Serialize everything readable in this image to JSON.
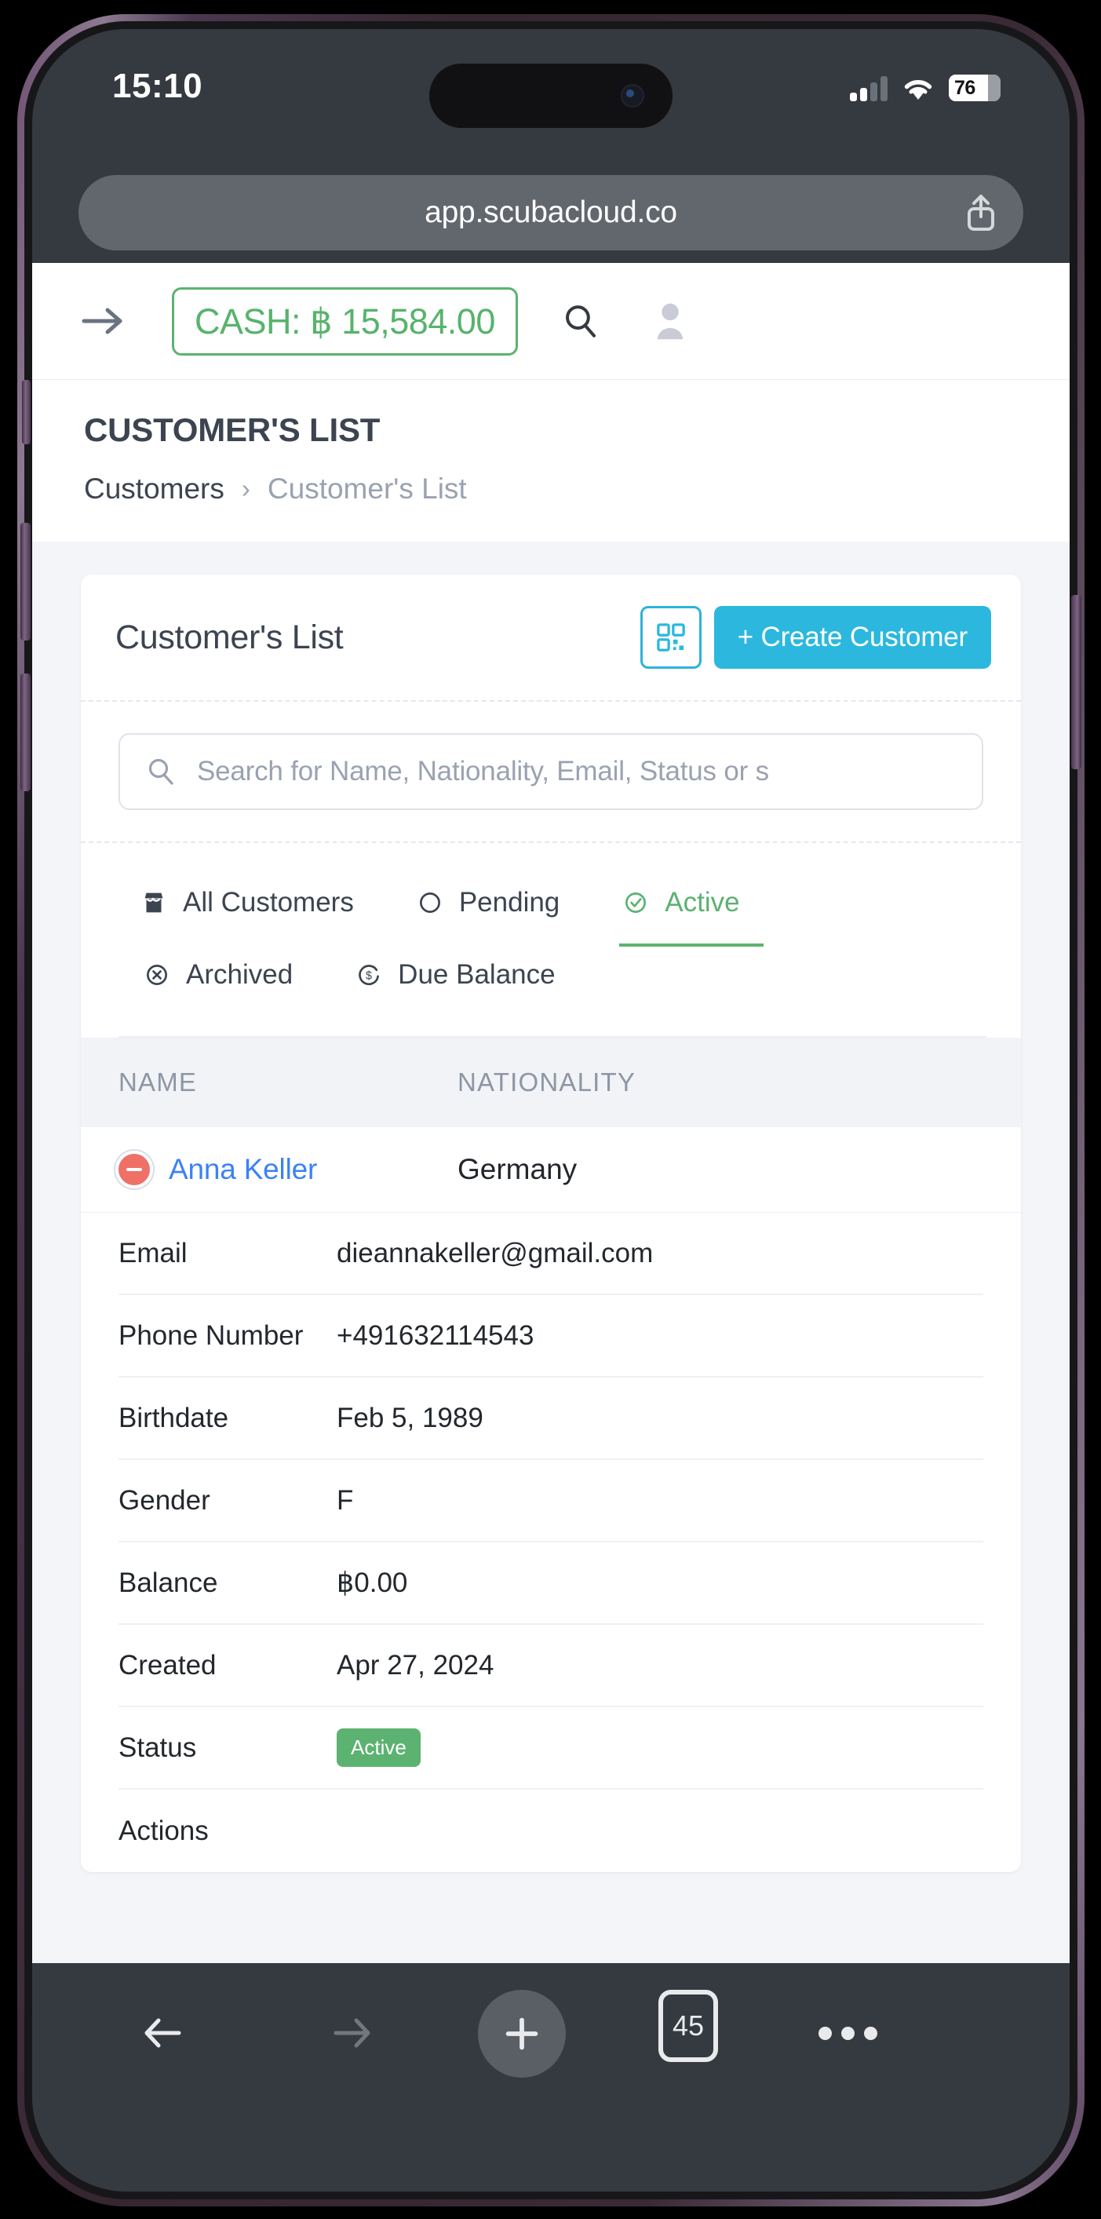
{
  "status_bar": {
    "time": "15:10",
    "battery_level": "76",
    "signal_icon": "cellular-signal-icon",
    "wifi_icon": "wifi-icon",
    "battery_icon": "battery-icon"
  },
  "browser": {
    "url": "app.scubacloud.co",
    "share_icon": "share-icon",
    "bottom": {
      "back_icon": "arrow-left-icon",
      "forward_icon": "arrow-right-icon",
      "new_tab_icon": "plus-icon",
      "tab_count": "45",
      "more_icon": "ellipsis-icon"
    }
  },
  "app_header": {
    "menu_icon": "arrow-right-icon",
    "cash_label": "CASH: ฿ 15,584.00",
    "search_icon": "search-icon",
    "avatar_icon": "user-avatar-icon",
    "accent_green": "#57b36c"
  },
  "page": {
    "title": "CUSTOMER'S LIST",
    "breadcrumb": {
      "root": "Customers",
      "separator": "›",
      "current": "Customer's List"
    }
  },
  "card": {
    "title": "Customer's List",
    "qr_icon": "qr-code-icon",
    "create_button": "+ Create Customer",
    "accent_cyan": "#2cb8de"
  },
  "search": {
    "icon": "search-icon",
    "placeholder": "Search for Name, Nationality, Email, Status or s"
  },
  "tabs": {
    "row1": [
      {
        "label": "All Customers",
        "icon": "store-icon",
        "active": false
      },
      {
        "label": "Pending",
        "icon": "circle-icon",
        "active": false
      },
      {
        "label": "Active",
        "icon": "check-circle-icon",
        "active": true
      }
    ],
    "row2": [
      {
        "label": "Archived",
        "icon": "x-circle-icon",
        "active": false
      },
      {
        "label": "Due Balance",
        "icon": "dollar-circle-icon",
        "active": false
      }
    ]
  },
  "table": {
    "headers": {
      "name": "NAME",
      "nationality": "NATIONALITY"
    },
    "row": {
      "status_marker": "minus-circle-icon",
      "name": "Anna Keller",
      "nationality": "Germany"
    },
    "details": [
      {
        "label": "Email",
        "value": "dieannakeller@gmail.com"
      },
      {
        "label": "Phone Number",
        "value": "+491632114543"
      },
      {
        "label": "Birthdate",
        "value": "Feb 5, 1989"
      },
      {
        "label": "Gender",
        "value": "F"
      },
      {
        "label": "Balance",
        "value": "฿0.00"
      },
      {
        "label": "Created",
        "value": "Apr 27, 2024"
      },
      {
        "label": "Status",
        "value": "Active",
        "badge": true
      },
      {
        "label": "Actions",
        "value": ""
      }
    ]
  }
}
